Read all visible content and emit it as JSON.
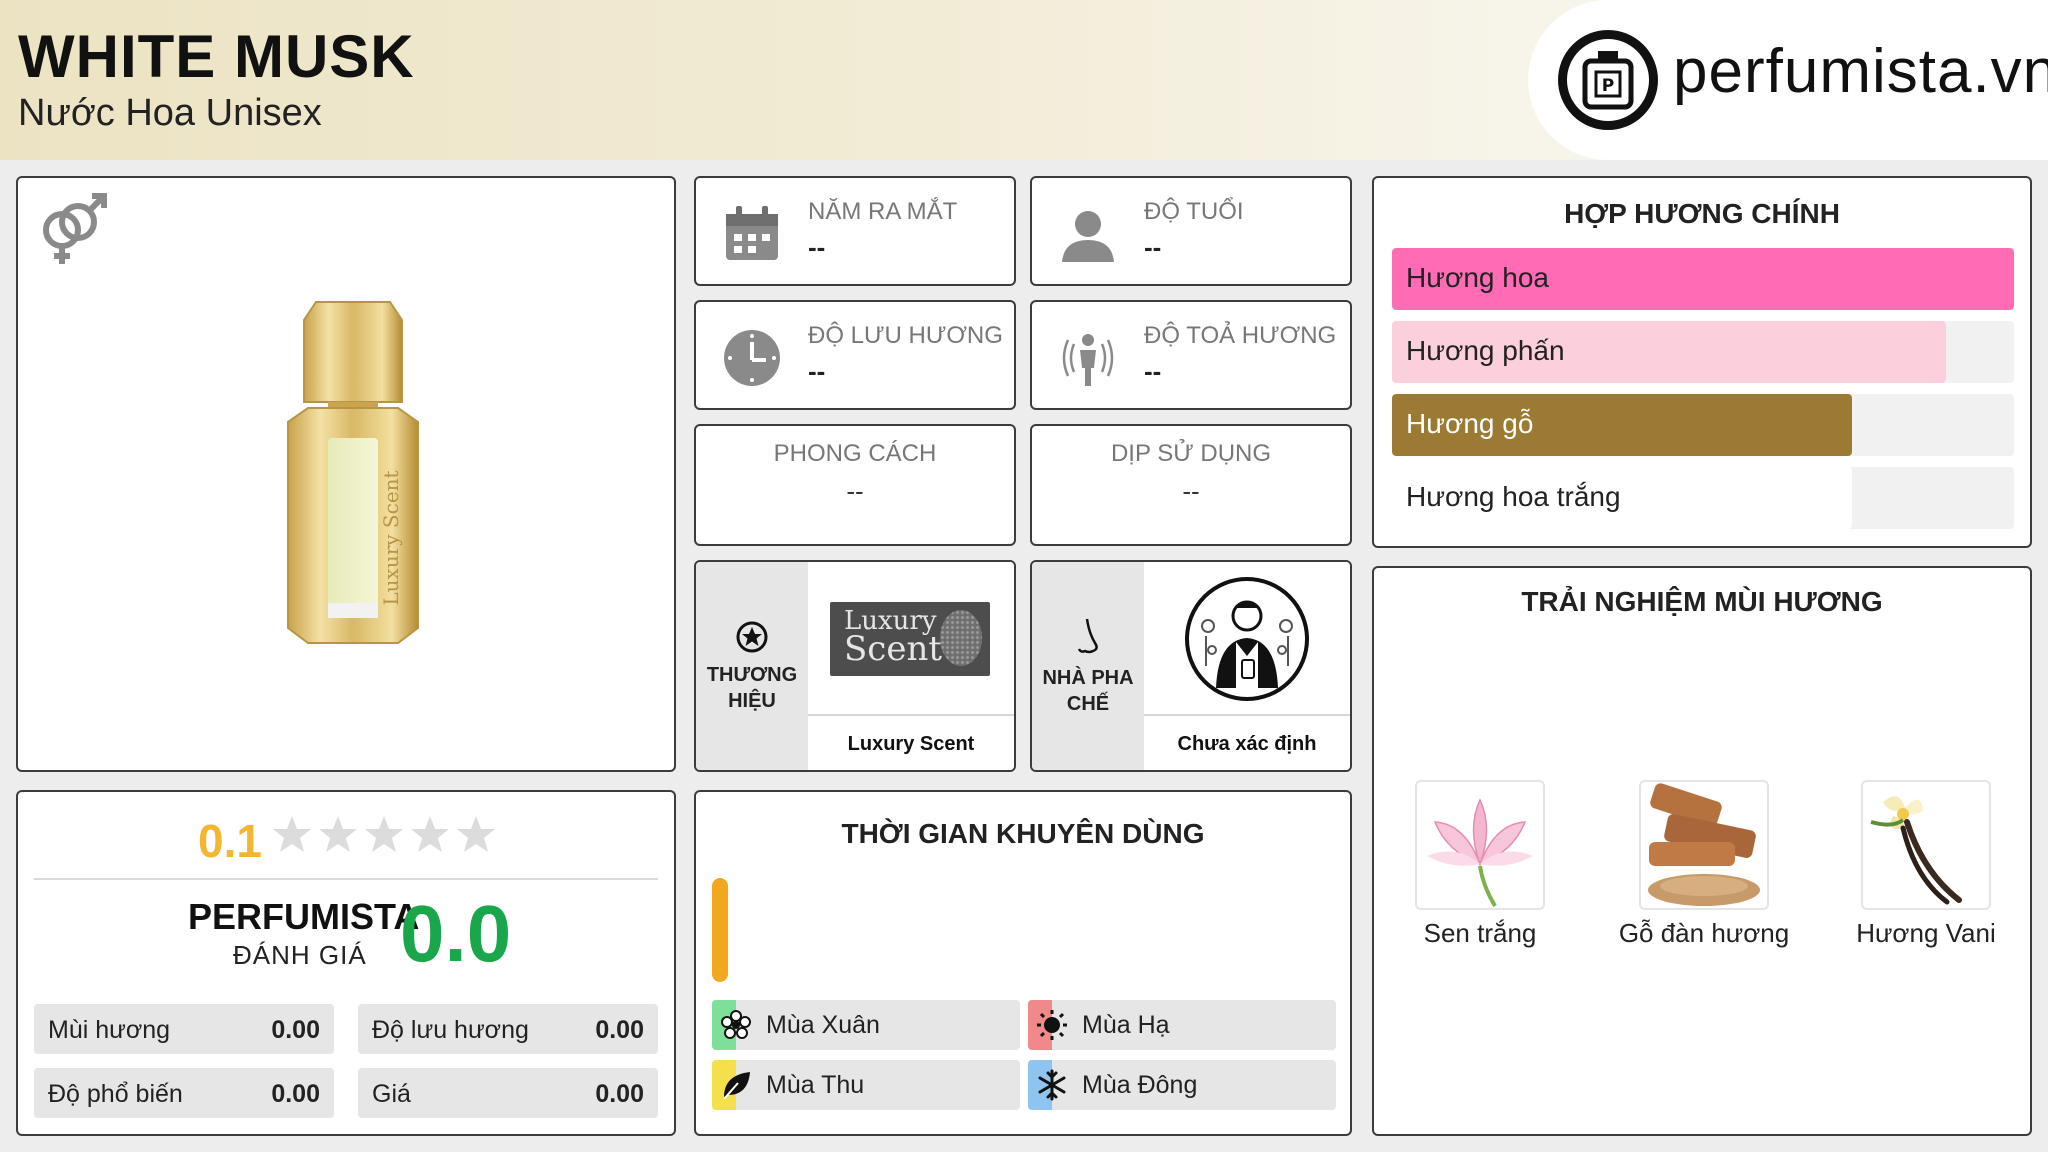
{
  "header": {
    "title": "WHITE MUSK",
    "subtitle": "Nước Hoa Unisex",
    "logo_text": "perfumista.vn",
    "accent_color": "#ece3c3"
  },
  "product": {
    "gender_icon": "unisex-gender-icon",
    "bottle_text": "Luxury Scent"
  },
  "info": {
    "year": {
      "label": "NĂM RA MẮT",
      "value": "--",
      "icon": "calendar-icon"
    },
    "age": {
      "label": "ĐỘ TUỔI",
      "value": "--",
      "icon": "user-icon"
    },
    "longevity": {
      "label": "ĐỘ LƯU HƯƠNG",
      "value": "--",
      "icon": "clock-icon"
    },
    "sillage": {
      "label": "ĐỘ TOẢ HƯƠNG",
      "value": "--",
      "icon": "sillage-icon"
    },
    "style": {
      "label": "PHONG CÁCH",
      "value": "--"
    },
    "occasion": {
      "label": "DỊP SỬ DỤNG",
      "value": "--"
    }
  },
  "brand": {
    "label": "THƯƠNG HIỆU",
    "logo_text_1": "Luxury",
    "logo_text_2": "Scent",
    "name": "Luxury Scent"
  },
  "perfumer": {
    "label": "NHÀ PHA CHẾ",
    "name": "Chưa xác định"
  },
  "accords": {
    "title": "HỢP HƯƠNG CHÍNH",
    "items": [
      {
        "label": "Hương hoa",
        "level": 1.0,
        "color": "#ff6bb5",
        "text_color": "#222"
      },
      {
        "label": "Hương phấn",
        "level": 0.89,
        "color": "#fbd0dc",
        "text_color": "#222"
      },
      {
        "label": "Hương gỗ",
        "level": 0.74,
        "color": "#9b7a33",
        "text_color": "#ffffff"
      },
      {
        "label": "Hương hoa trắng",
        "level": 0.74,
        "color": "#ffffff",
        "text_color": "#222"
      }
    ]
  },
  "notes": {
    "title": "TRẢI NGHIỆM MÙI HƯƠNG",
    "items": [
      {
        "name": "Sen trắng"
      },
      {
        "name": "Gỗ đàn hương"
      },
      {
        "name": "Hương Vani"
      }
    ]
  },
  "rating": {
    "score": "0.1",
    "stars_filled": 0,
    "stars_total": 5,
    "pf_title": "PERFUMISTA",
    "pf_sub": "ĐÁNH GIÁ",
    "pf_score": "0.0",
    "metrics": [
      {
        "label": "Mùi hương",
        "value": "0.00"
      },
      {
        "label": "Độ lưu hương",
        "value": "0.00"
      },
      {
        "label": "Độ phổ biến",
        "value": "0.00"
      },
      {
        "label": "Giá",
        "value": "0.00"
      }
    ]
  },
  "seasons": {
    "title": "THỜI GIAN KHUYÊN DÙNG",
    "items": [
      {
        "label": "Mùa Xuân",
        "color": "#7ddf9a",
        "icon": "flower-icon"
      },
      {
        "label": "Mùa Hạ",
        "color": "#f08a8a",
        "icon": "sun-icon"
      },
      {
        "label": "Mùa Thu",
        "color": "#f3e04a",
        "icon": "leaf-icon"
      },
      {
        "label": "Mùa Đông",
        "color": "#8fc3f0",
        "icon": "snowflake-icon"
      }
    ]
  }
}
